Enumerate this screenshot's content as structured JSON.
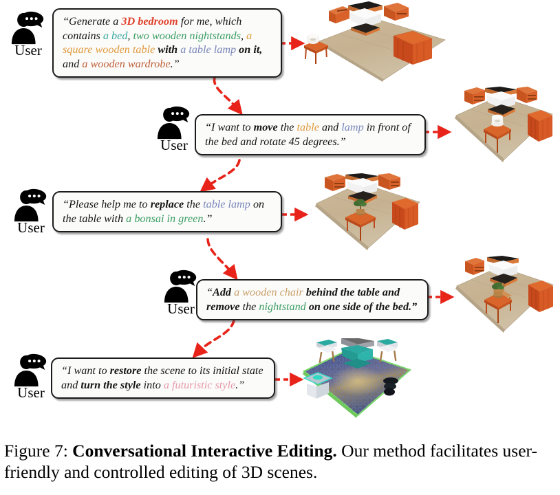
{
  "figure": {
    "caption_prefix": "Figure 7:",
    "caption_title": "Conversational Interactive Editing.",
    "caption_body": "Our method facilitates user-friendly and controlled editing of 3D scenes."
  },
  "colors": {
    "highlight_red": "#e0402a",
    "highlight_teal": "#3aa8a0",
    "highlight_green": "#3c9e63",
    "highlight_orange": "#e09a3c",
    "highlight_slate": "#7a86b8",
    "highlight_sienna": "#c1603a",
    "highlight_pink": "#e69aa8",
    "arrow_red": "#e8231a",
    "bubble_bg": "#fbfbfa",
    "bubble_border": "#1b1b1b",
    "text": "#141414"
  },
  "user": {
    "label": "User",
    "icon": "user-speech-bubble-icon"
  },
  "turns": [
    {
      "id": 1,
      "speaker_label": "User",
      "segments": [
        {
          "t": "“Generate a ",
          "style": "italic",
          "color": "#141414"
        },
        {
          "t": "3D bedroom",
          "style": "bold-italic",
          "color": "#e0402a"
        },
        {
          "t": " for me, which contains ",
          "style": "italic",
          "color": "#141414"
        },
        {
          "t": "a bed",
          "style": "italic",
          "color": "#3aa8a0"
        },
        {
          "t": ", ",
          "style": "italic",
          "color": "#141414"
        },
        {
          "t": "two wooden nightstands",
          "style": "italic",
          "color": "#3c9e63"
        },
        {
          "t": ", ",
          "style": "italic",
          "color": "#141414"
        },
        {
          "t": "a square wooden table",
          "style": "italic",
          "color": "#e09a3c"
        },
        {
          "t": " with ",
          "style": "bold-italic",
          "color": "#141414"
        },
        {
          "t": "a table lamp",
          "style": "italic",
          "color": "#7a86b8"
        },
        {
          "t": " on it,",
          "style": "bold-italic",
          "color": "#141414"
        },
        {
          "t": " and ",
          "style": "italic",
          "color": "#141414"
        },
        {
          "t": "a wooden wardrobe",
          "style": "italic",
          "color": "#c1603a"
        },
        {
          "t": ".”",
          "style": "italic",
          "color": "#141414"
        }
      ],
      "plain": "“Generate a 3D bedroom for me, which contains a bed, two wooden nightstands, a square wooden table with a table lamp on it, and a wooden wardrobe.”",
      "scene_name": "scene-initial-bedroom"
    },
    {
      "id": 2,
      "speaker_label": "User",
      "segments": [
        {
          "t": "“I want to ",
          "style": "italic",
          "color": "#141414"
        },
        {
          "t": "move",
          "style": "bold-italic",
          "color": "#141414"
        },
        {
          "t": " the ",
          "style": "italic",
          "color": "#141414"
        },
        {
          "t": "table",
          "style": "italic",
          "color": "#e09a3c"
        },
        {
          "t": " and ",
          "style": "italic",
          "color": "#141414"
        },
        {
          "t": "lamp",
          "style": "italic",
          "color": "#7a86b8"
        },
        {
          "t": " in front of the bed and rotate 45 degrees.”",
          "style": "italic",
          "color": "#141414"
        }
      ],
      "plain": "“I want to move the table and lamp in front of the bed and rotate 45 degrees.”",
      "scene_name": "scene-table-moved"
    },
    {
      "id": 3,
      "speaker_label": "User",
      "segments": [
        {
          "t": "“Please help me to ",
          "style": "italic",
          "color": "#141414"
        },
        {
          "t": "replace",
          "style": "bold-italic",
          "color": "#141414"
        },
        {
          "t": " the ",
          "style": "italic",
          "color": "#141414"
        },
        {
          "t": "table lamp",
          "style": "italic",
          "color": "#7a86b8"
        },
        {
          "t": " on the table with ",
          "style": "italic",
          "color": "#141414"
        },
        {
          "t": "a bonsai in green",
          "style": "italic",
          "color": "#3c9e63"
        },
        {
          "t": ".”",
          "style": "italic",
          "color": "#141414"
        }
      ],
      "plain": "“Please help me to replace the table lamp on the table with a bonsai in green.”",
      "scene_name": "scene-bonsai-replaced"
    },
    {
      "id": 4,
      "speaker_label": "User",
      "segments": [
        {
          "t": "“",
          "style": "italic",
          "color": "#141414"
        },
        {
          "t": "Add",
          "style": "bold-italic",
          "color": "#141414"
        },
        {
          "t": " a wooden chair",
          "style": "italic",
          "color": "#c9a06a"
        },
        {
          "t": " behind the table and ",
          "style": "bold-italic",
          "color": "#141414"
        },
        {
          "t": "remove",
          "style": "bold-italic",
          "color": "#141414"
        },
        {
          "t": " the ",
          "style": "italic",
          "color": "#141414"
        },
        {
          "t": "nightstand",
          "style": "italic",
          "color": "#3c9e63"
        },
        {
          "t": " on one side of the bed.”",
          "style": "bold-italic",
          "color": "#141414"
        }
      ],
      "plain": "“Add a wooden chair behind the table and remove the nightstand on one side of the bed.”",
      "scene_name": "scene-chair-added"
    },
    {
      "id": 5,
      "speaker_label": "User",
      "segments": [
        {
          "t": "“I want to ",
          "style": "italic",
          "color": "#141414"
        },
        {
          "t": "restore",
          "style": "bold-italic",
          "color": "#141414"
        },
        {
          "t": " the scene to its initial state and ",
          "style": "italic",
          "color": "#141414"
        },
        {
          "t": "turn the style",
          "style": "bold-italic",
          "color": "#141414"
        },
        {
          "t": " into ",
          "style": "italic",
          "color": "#141414"
        },
        {
          "t": "a futuristic style",
          "style": "italic",
          "color": "#e69aa8"
        },
        {
          "t": ".”",
          "style": "italic",
          "color": "#141414"
        }
      ],
      "plain": "“I want to restore the scene to its initial state and turn the style into a futuristic style.”",
      "scene_name": "scene-futuristic"
    }
  ],
  "scenes": [
    {
      "name": "scene-initial-bedroom",
      "description": "3D bedroom with bed, two nightstands, square wooden table with table lamp, wooden wardrobe"
    },
    {
      "name": "scene-table-moved",
      "description": "Table and lamp moved in front of the bed, rotated 45 degrees"
    },
    {
      "name": "scene-bonsai-replaced",
      "description": "Table lamp replaced with a green bonsai on the table"
    },
    {
      "name": "scene-chair-added",
      "description": "Wooden chair added behind table, one nightstand removed"
    },
    {
      "name": "scene-futuristic",
      "description": "Scene restored to initial state and restyled in a futuristic blue style"
    }
  ]
}
